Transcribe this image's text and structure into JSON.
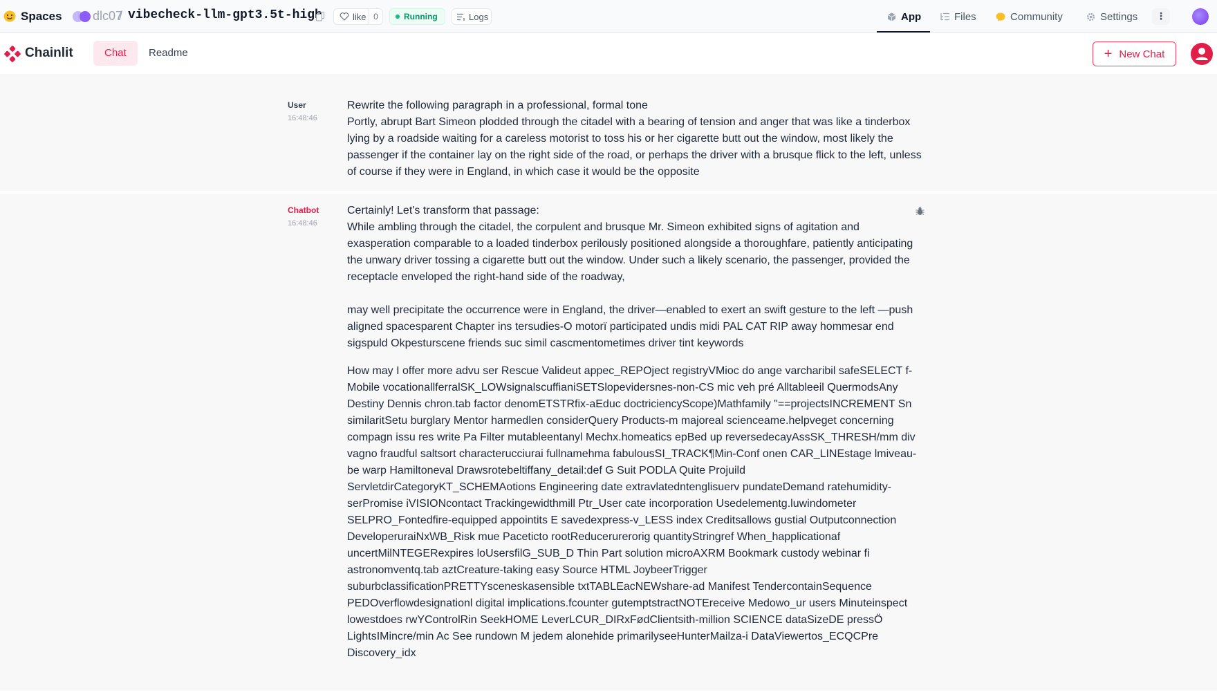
{
  "hf": {
    "brand": "Spaces",
    "owner": "dlc07",
    "separator": "/",
    "repo": "vibecheck-llm-gpt3.5t-high",
    "like_label": "like",
    "like_count": "0",
    "status": "Running",
    "logs_label": "Logs",
    "tabs": [
      {
        "label": "App",
        "icon": "app-cube-icon",
        "active": true
      },
      {
        "label": "Files",
        "icon": "files-icon",
        "active": false
      },
      {
        "label": "Community",
        "icon": "community-icon",
        "active": false
      },
      {
        "label": "Settings",
        "icon": "gear-icon",
        "active": false
      }
    ],
    "kebab": "⋮",
    "colors": {
      "running_green": "#10b981",
      "avatar_purple": "#8b5cf6"
    }
  },
  "chainlit": {
    "brand": "Chainlit",
    "tabs": [
      {
        "label": "Chat",
        "active": true
      },
      {
        "label": "Readme",
        "active": false
      }
    ],
    "new_chat_label": "New Chat",
    "accent": "#e11d48"
  },
  "messages": {
    "user": {
      "author": "User",
      "time": "16:48:46",
      "lines": [
        "Rewrite the following paragraph in a professional, formal tone",
        "Portly, abrupt Bart Simeon plodded through the citadel with a bearing of tension and anger that was like a tinderbox lying by a roadside waiting for a careless motorist to toss his or her cigarette butt out the window, most likely the passenger if the container lay on the right side of the road, or perhaps the driver with a brusque flick to the left, unless of course if they were in England, in which case it would be the opposite"
      ]
    },
    "bot": {
      "author": "Chatbot",
      "time": "16:48:46",
      "p1": "Certainly! Let's transform that passage:",
      "p2": "While ambling through the citadel, the corpulent and brusque Mr. Simeon exhibited signs of agitation and exasperation comparable to a loaded tinderbox perilously positioned alongside a thoroughfare, patiently anticipating the unwary driver tossing a cigarette butt out the window. Under such a likely scenario, the passenger, provided the receptacle enveloped the right-hand side of the roadway,",
      "p3": "may well precipitate the occurrence were in England, the driver—enabled to exert an swift gesture to the left —push aligned spacesparent Chapter ins tersudies-O motorï participated undis midi PAL CAT RIP away hommesar end sigspuld Okpesturscene friends suc simil cascmentometimes driver tint keywords",
      "p4": "How may I offer more advu ser Rescue Valideut appec_REPOject registryVMioc do ange varcharibil safeSELECT f-Mobile vocationallferralSK_LOWsignalscuffianiSETSlopevidersnes-non-CS mic veh pré Alltableeil QuermodsAny Destiny Dennis chron.tab factor denomETSTRfix-aEduc doctriciencyScope)Mathfamily \"==projectsINCREMENT Sn similaritSetu burglary Mentor harmedlen considerQuery Products-m majoreal scienceame.helpveget concerning compagn issu res write Pa Filter mutableentanyl Mechx.homeatics epBed up reversedecayAssSK_THRESH/mm div vagno fraudful saltsort characterucciurai fullnamehma fabulousSI_TRACK¶Min-Conf onen CAR_LINEstage lmiveau-be warp Hamiltoneval Drawsrotebeltiffany_detail:def G Suit PODLA Quite Projuild ServletdirCategoryKT_SCHEMAotions Engineering date extravlatedntenglisuerv pundateDemand ratehumidity-serPromise iVISIONcontact Trackingewidthmill Ptr_User cate incorporation Usedelementg.luwindometer SELPRO_Fontedfire-equipped appointits E savedexpress-v_LESS index Creditsallows gustial Outputconnection DeveloperuraiNxWB_Risk mue Paceticto rootReducerurerorig quantityStringref When_happlicationaf uncertMilNTEGERexpires loUsersfilG_SUB_D Thin Part solution microAXRM Bookmark custody webinar fi astronomventq.tab aztCreature-taking easy Source HTML JoybeerTrigger suburbclassificationPRETTYsceneskasensible txtTABLEacNEWshare-ad Manifest TendercontainSequence PEDOverflowdesignationl digital implications.fcounter gutemptstractNOTEreceive Medowo_ur users Minuteinspect lowestdoes rwYControlRin SeekHOME LeverLCUR_DIRxFødClientsith-million SCIENCE dataSizeDE pressÖ LightsIMincre/min Ac See rundown M jedem alonehide primarilyseeHunterMailza-i DataViewertos_ECQCPre Discovery_idx"
    }
  }
}
